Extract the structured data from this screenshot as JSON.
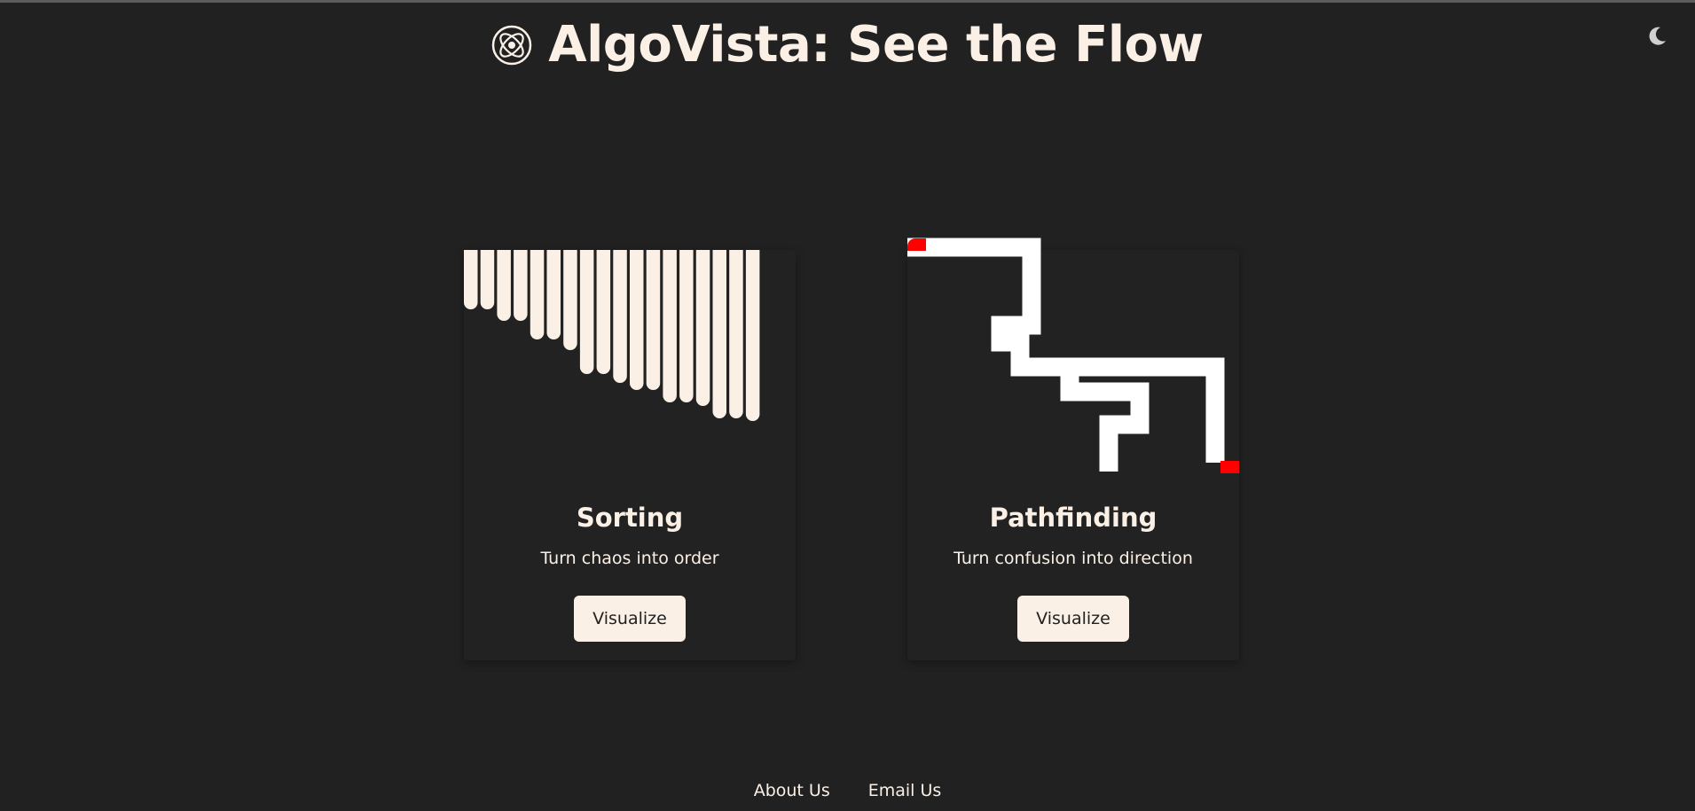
{
  "header": {
    "title": "AlgoVista: See the Flow",
    "logo_icon": "atom-swirl-logo-icon",
    "theme_toggle_icon": "moon-icon"
  },
  "cards": [
    {
      "title": "Sorting",
      "description": "Turn chaos into order",
      "button_label": "Visualize",
      "illustration": "sorted-bars-icon"
    },
    {
      "title": "Pathfinding",
      "description": "Turn confusion into direction",
      "button_label": "Visualize",
      "illustration": "maze-path-icon"
    }
  ],
  "footer": {
    "links": [
      "About Us",
      "Email Us"
    ]
  },
  "colors": {
    "background": "#212121",
    "text": "#faf0e6",
    "path": "#ffffff",
    "path_endpoints": "#ff0000"
  }
}
